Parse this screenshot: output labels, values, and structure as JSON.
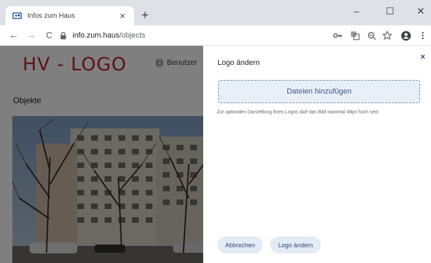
{
  "browser": {
    "tab_title": "Infos zum Haus",
    "tab_close": "×",
    "new_tab": "+",
    "window_controls": {
      "minimize": "–",
      "maximize": "☐",
      "close": "✕"
    },
    "url_host": "info.zum.haus",
    "url_path": "/objects",
    "nav": {
      "back": "←",
      "forward": "→",
      "reload": "C"
    },
    "toolbar_icons": [
      "key-icon",
      "translate-icon",
      "zoom-icon",
      "star-icon",
      "profile-icon",
      "menu-icon"
    ]
  },
  "page": {
    "logo": "HV - LOGO",
    "nav_benutzer": "Benutzer",
    "section_title": "Objekte"
  },
  "panel": {
    "title": "Logo ändern",
    "close": "×",
    "dropzone_label": "Dateien hinzufügen",
    "hint": "Zur optimalen Darstellung Ihres Logos darf das Bild maximal 48px hoch sein",
    "cancel_label": "Abbrechen",
    "save_label": "Logo ändern"
  },
  "colors": {
    "logo": "#c0202a",
    "accent": "#3a5a85",
    "button_bg": "#e3ebf5"
  }
}
